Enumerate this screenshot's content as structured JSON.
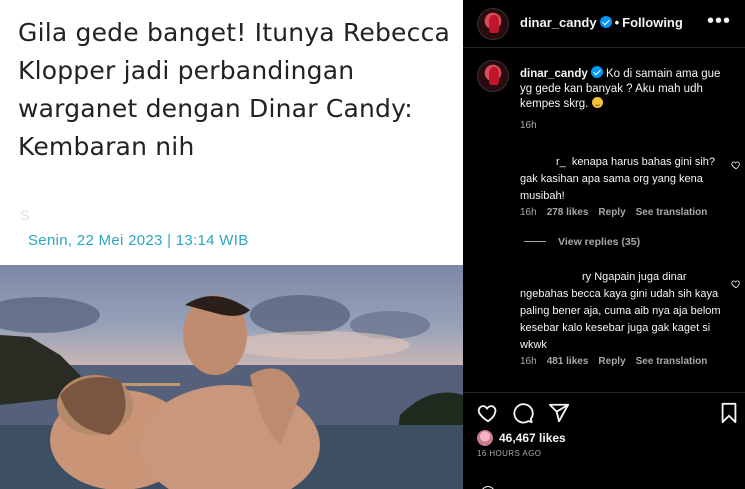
{
  "article": {
    "title": "Gila gede banget! Itunya Rebecca Klopper jadi perbandingan warganet dengan Dinar Candy: Kembaran nih",
    "date": "Senin, 22 Mei 2023 | 13:14 WIB",
    "ghost_char": "S"
  },
  "header": {
    "username": "dinar_candy",
    "separator": "•",
    "follow_status": "Following",
    "more": "•••"
  },
  "caption": {
    "username": "dinar_candy",
    "text": "Ko di samain ama gue yg gede kan banyak ? Aku mah udh kempes skrg.",
    "time": "16h"
  },
  "comments": [
    {
      "username": "r_",
      "text": "kenapa harus bahas gini sih? gak kasihan apa sama org yang kena musibah!",
      "time": "16h",
      "likes": "278 likes",
      "reply": "Reply",
      "translate": "See translation"
    },
    {
      "username": "ry",
      "text": "Ngapain juga dinar ngebahas becca kaya gini udah sih kaya paling bener aja, cuma aib nya aja belom kesebar kalo kesebar juga gak kaget si wkwk",
      "time": "16h",
      "likes": "481 likes",
      "reply": "Reply",
      "translate": "See translation"
    }
  ],
  "view_replies": "View replies (35)",
  "post": {
    "likes": "46,467 likes",
    "time_ago": "16 HOURS AGO"
  },
  "icons": [
    "heart-icon",
    "comment-icon",
    "share-icon",
    "bookmark-icon",
    "more-icon",
    "verified-badge-icon"
  ],
  "colors": {
    "background": "#000000",
    "text": "#f5f5f5",
    "muted": "#a8a8a8",
    "verified": "#0095f6",
    "date_accent": "#2ba6c4"
  }
}
